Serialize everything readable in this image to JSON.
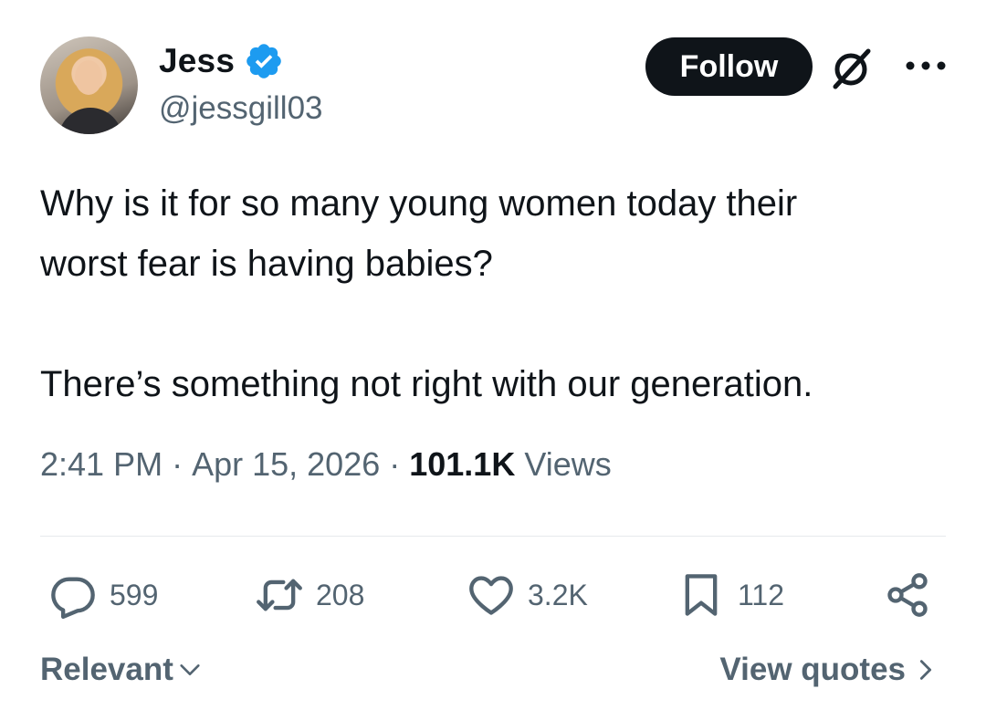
{
  "author": {
    "name": "Jess",
    "handle": "@jessgill03",
    "verified": true,
    "verified_color": "#1d9bf0"
  },
  "header": {
    "follow_label": "Follow",
    "grok_icon": "grok-icon",
    "more_icon": "more-horizontal-icon"
  },
  "tweet": {
    "text": "Why is it for so many young women today their\nworst fear is having babies?\n\nThere’s something not right with our generation.",
    "time": "2:41 PM",
    "separator": " · ",
    "date": "Apr 15, 2026",
    "views_count": "101.1K",
    "views_label": " Views"
  },
  "actions": {
    "replies": "599",
    "retweets": "208",
    "likes": "3.2K",
    "bookmarks": "112"
  },
  "footer": {
    "sort_label": "Relevant",
    "quotes_label": "View quotes"
  },
  "colors": {
    "text": "#0f1419",
    "secondary": "#536471",
    "divider": "#e6e9ec"
  }
}
